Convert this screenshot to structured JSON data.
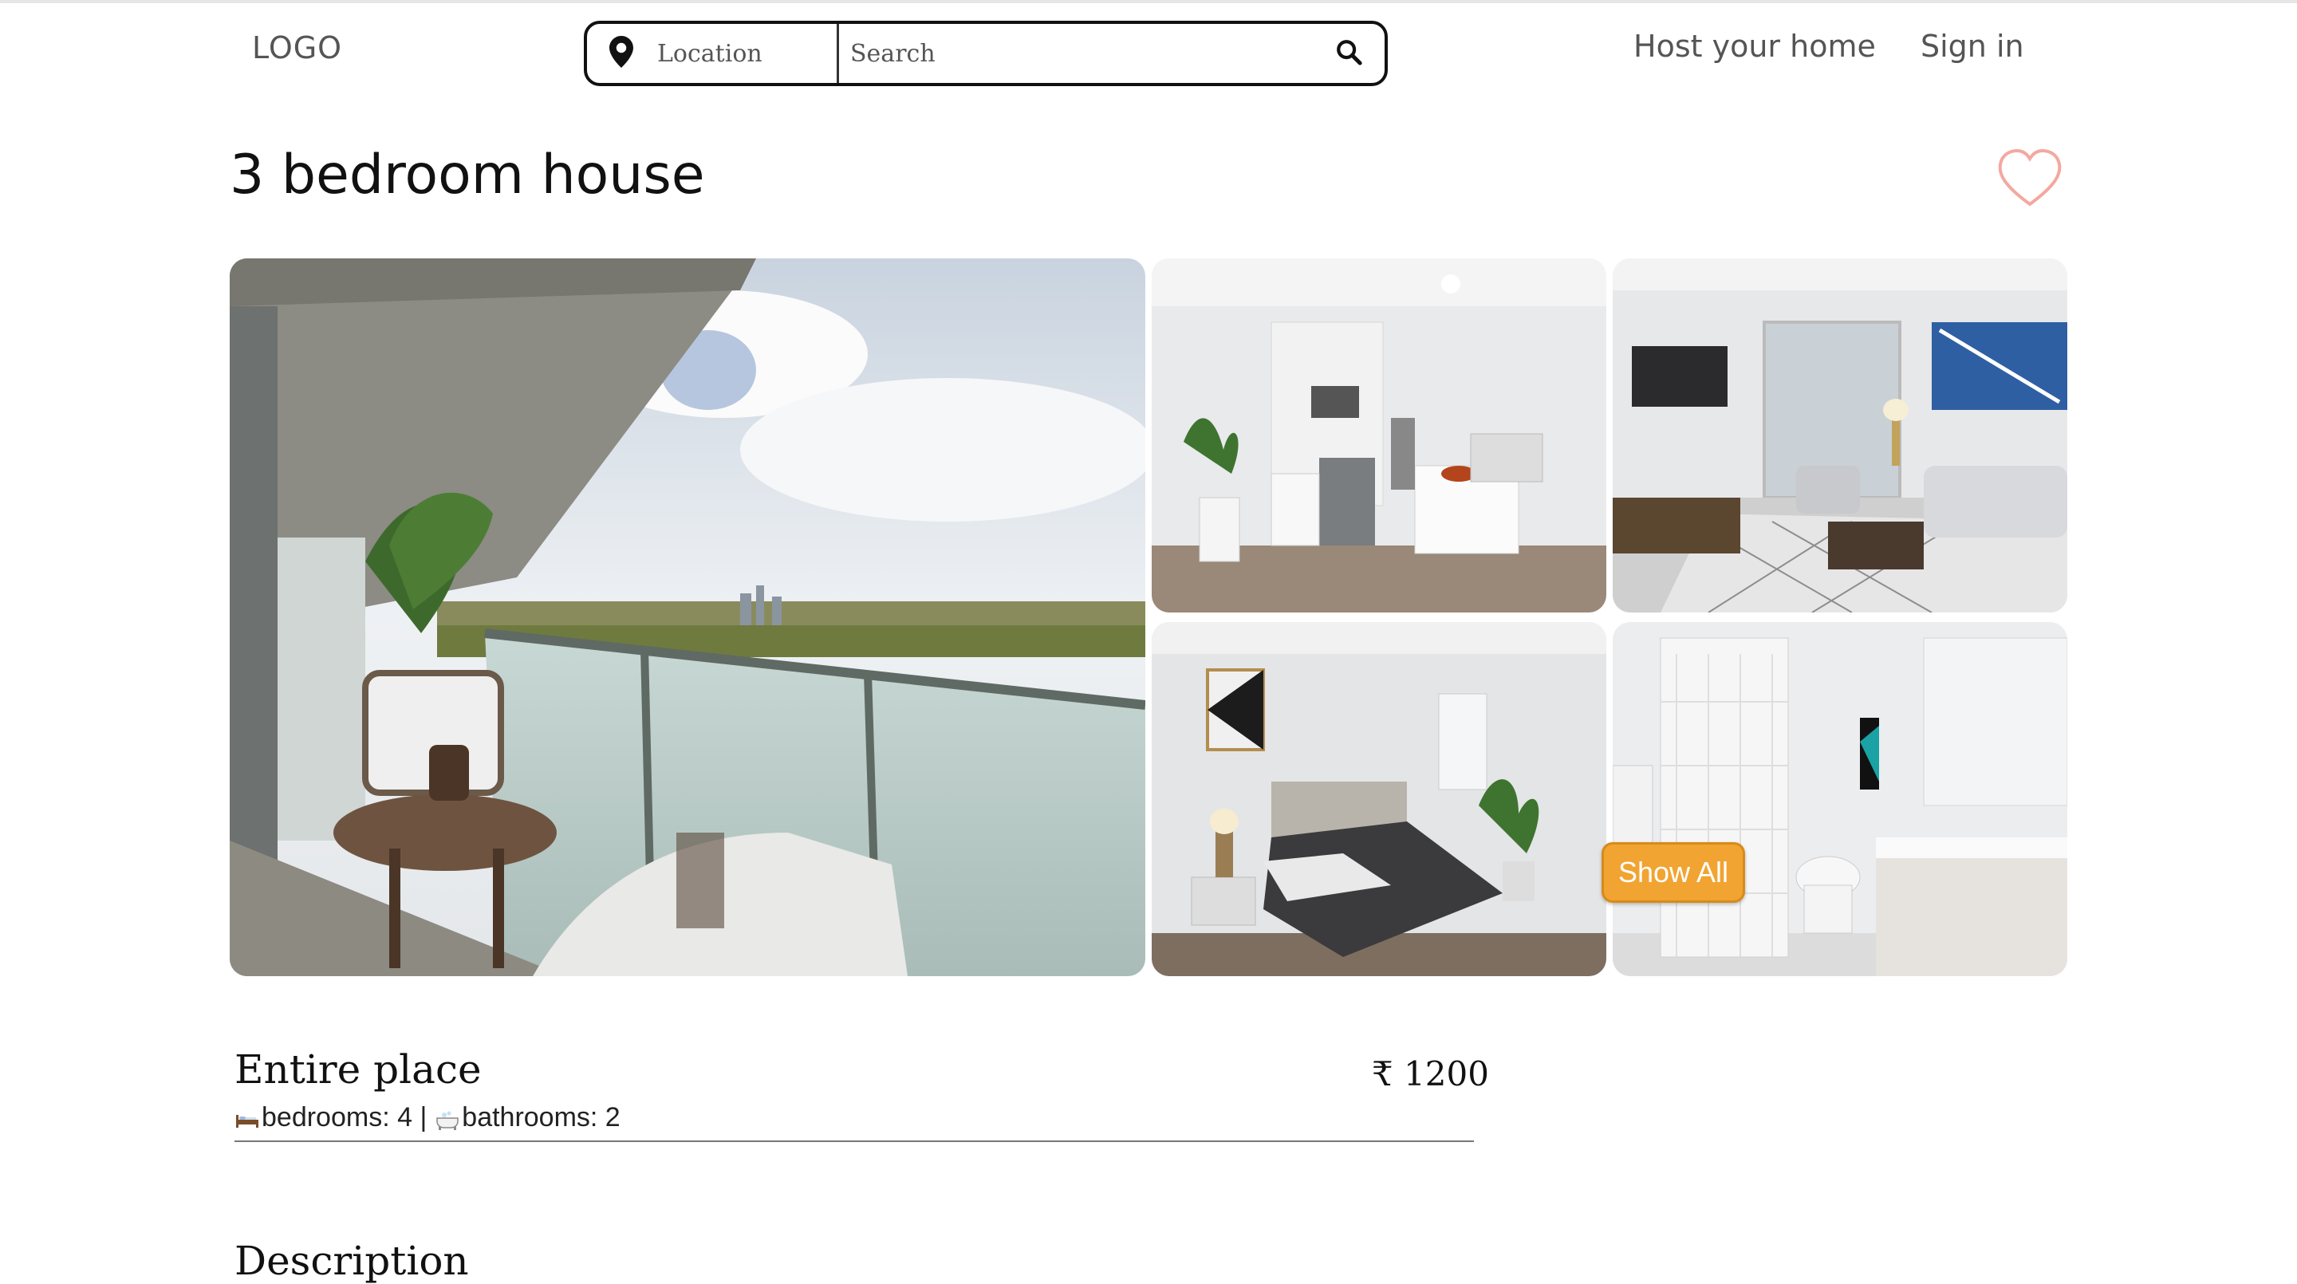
{
  "header": {
    "logo": "LOGO",
    "location_placeholder": "Location",
    "search_placeholder": "Search",
    "host_link": "Host your home",
    "signin_link": "Sign in"
  },
  "listing": {
    "title": "3 bedroom house",
    "property_type": "Entire place",
    "price": "₹ 1200",
    "bedrooms_text": "bedrooms: 4 |",
    "bathrooms_text": "bathrooms: 2",
    "description_heading": "Description"
  },
  "gallery": {
    "show_all_label": "Show All",
    "photos": [
      "balcony-view",
      "kitchen",
      "living-room",
      "bedroom",
      "bathroom"
    ]
  },
  "icons": {
    "location": "map-pin-icon",
    "search": "magnifier-icon",
    "favorite": "heart-outline-icon",
    "bed": "bed-icon",
    "bath": "bathtub-icon"
  },
  "colors": {
    "accent_button": "#f1a431",
    "heart_outline": "#f4a8a0"
  }
}
